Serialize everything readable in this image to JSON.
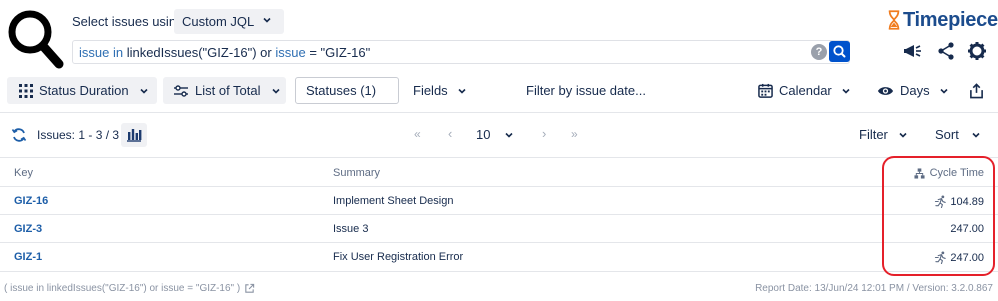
{
  "header": {
    "select_label": "Select issues using",
    "select_value": "Custom JQL",
    "jql": {
      "part1_kw": "issue in",
      "part2": " linkedIssues(\"GIZ-16\") or ",
      "part3_kw": "issue",
      "part4": " = \"GIZ-16\""
    },
    "help": "?",
    "logo": "Timepiece",
    "icons": [
      "search-glass-icon",
      "announce-icon",
      "share-icon",
      "settings-icon"
    ]
  },
  "toolbar": {
    "status_duration": "Status Duration",
    "list_of_total": "List of Total",
    "statuses": "Statuses (1)",
    "fields": "Fields",
    "filter_date": "Filter by issue date...",
    "calendar": "Calendar",
    "days": "Days"
  },
  "subbar": {
    "issues": "Issues: 1 - 3 / 3",
    "page_size": "10",
    "filter": "Filter",
    "sort": "Sort"
  },
  "table": {
    "columns": [
      "Key",
      "Summary",
      "Cycle Time"
    ],
    "rows": [
      {
        "key": "GIZ-16",
        "summary": "Implement Sheet Design",
        "cycle": "104.89",
        "runner": true
      },
      {
        "key": "GIZ-3",
        "summary": "Issue 3",
        "cycle": "247.00",
        "runner": false
      },
      {
        "key": "GIZ-1",
        "summary": "Fix User Registration Error",
        "cycle": "247.00",
        "runner": true
      }
    ]
  },
  "footer": {
    "query": "( issue in linkedIssues(\"GIZ-16\") or issue = \"GIZ-16\" )",
    "report": "Report Date: 13/Jun/24 12:01 PM / Version: 3.2.0.867"
  },
  "colors": {
    "accent": "#0052cc",
    "link": "#1d5ea8",
    "highlight": "#e5202a",
    "logo_orange": "#f07c1f"
  }
}
